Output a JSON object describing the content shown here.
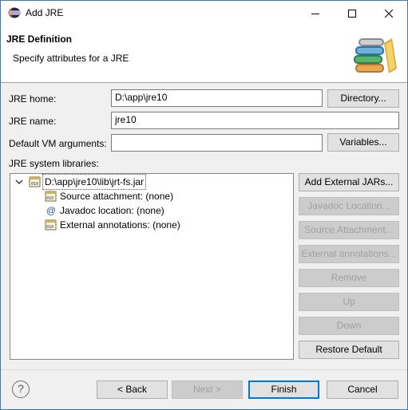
{
  "window": {
    "title": "Add JRE"
  },
  "banner": {
    "title": "JRE Definition",
    "message": "Specify attributes for a JRE"
  },
  "form": {
    "jre_home_label": "JRE home:",
    "jre_home_value": "D:\\app\\jre10",
    "directory_button": "Directory...",
    "jre_name_label": "JRE name:",
    "jre_name_value": "jre10",
    "vm_args_label": "Default VM arguments:",
    "vm_args_value": "",
    "variables_button": "Variables...",
    "system_libraries_label": "JRE system libraries:"
  },
  "libraries": {
    "jar": "D:\\app\\jre10\\lib\\jrt-fs.jar",
    "children": [
      {
        "label": "Source attachment: (none)",
        "icon": "source-attachment-icon"
      },
      {
        "label": "Javadoc location: (none)",
        "icon": "javadoc-icon"
      },
      {
        "label": "External annotations: (none)",
        "icon": "external-annotations-icon"
      }
    ]
  },
  "side_buttons": {
    "add_external_jars": "Add External JARs...",
    "javadoc_location": "Javadoc Location...",
    "source_attachment": "Source Attachment...",
    "external_annotations": "External annotations...",
    "remove": "Remove",
    "up": "Up",
    "down": "Down",
    "restore_default": "Restore Default"
  },
  "footer": {
    "help": "?",
    "back": "< Back",
    "next": "Next >",
    "finish": "Finish",
    "cancel": "Cancel"
  },
  "colors": {
    "accent": "#0078d7",
    "disabled_text": "#a0a0a0"
  }
}
